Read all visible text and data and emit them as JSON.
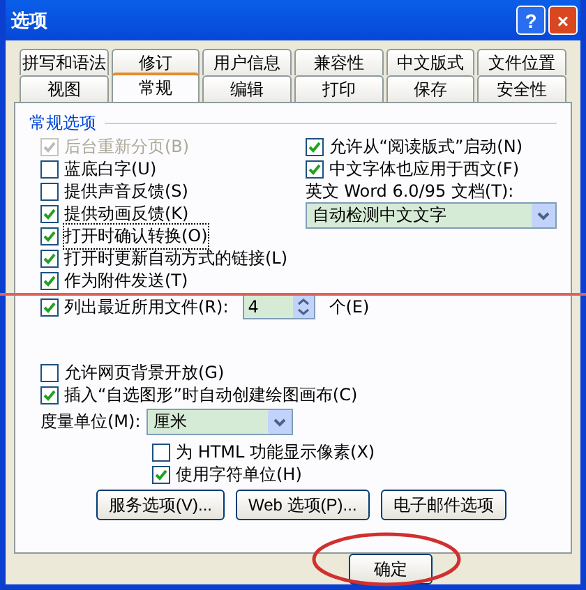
{
  "window": {
    "title": "选项",
    "buttons": [
      {
        "kind": "help",
        "label": "?"
      },
      {
        "kind": "close",
        "label": "×"
      }
    ]
  },
  "tabs": [
    [
      {
        "label": "拼写和语法",
        "selected": false
      },
      {
        "label": "修订",
        "selected": false
      },
      {
        "label": "用户信息",
        "selected": false
      },
      {
        "label": "兼容性",
        "selected": false
      },
      {
        "label": "中文版式",
        "selected": false
      },
      {
        "label": "文件位置",
        "selected": false
      }
    ],
    [
      {
        "label": "视图",
        "selected": false
      },
      {
        "label": "常规",
        "selected": true
      },
      {
        "label": "编辑",
        "selected": false
      },
      {
        "label": "打印",
        "selected": false
      },
      {
        "label": "保存",
        "selected": false
      },
      {
        "label": "安全性",
        "selected": false
      }
    ]
  ],
  "group": {
    "title": "常规选项",
    "left": [
      {
        "label": "后台重新分页(B)",
        "checked": true,
        "disabled": true,
        "focused": false
      },
      {
        "label": "蓝底白字(U)",
        "checked": false,
        "disabled": false,
        "focused": false
      },
      {
        "label": "提供声音反馈(S)",
        "checked": false,
        "disabled": false,
        "focused": false
      },
      {
        "label": "提供动画反馈(K)",
        "checked": true,
        "disabled": false,
        "focused": false
      },
      {
        "label": "打开时确认转换(O)",
        "checked": true,
        "disabled": false,
        "focused": true
      },
      {
        "label": "打开时更新自动方式的链接(L)",
        "checked": true,
        "disabled": false,
        "focused": false
      },
      {
        "label": "作为附件发送(T)",
        "checked": true,
        "disabled": false,
        "focused": false
      }
    ],
    "right": [
      {
        "label": "允许从“阅读版式”启动(N)",
        "checked": true
      },
      {
        "label": "中文字体也应用于西文(F)",
        "checked": true
      }
    ],
    "word_label": "英文 Word 6.0/95 文档(T):",
    "word_select": "自动检测中文文字",
    "recent": {
      "label": "列出最近所用文件(R):",
      "checked": true,
      "value": "4",
      "unit": "个(E)"
    },
    "lower": [
      {
        "label": "允许网页背景开放(G)",
        "checked": false
      },
      {
        "label": "插入“自选图形”时自动创建绘图画布(C)",
        "checked": true
      }
    ],
    "measure": {
      "label": "度量单位(M):",
      "value": "厘米"
    },
    "sub": [
      {
        "label": "为 HTML 功能显示像素(X)",
        "checked": false
      },
      {
        "label": "使用字符单位(H)",
        "checked": true
      }
    ],
    "buttons": [
      "服务选项(V)...",
      "Web 选项(P)...",
      "电子邮件选项"
    ]
  },
  "footer": {
    "ok": "确定"
  }
}
